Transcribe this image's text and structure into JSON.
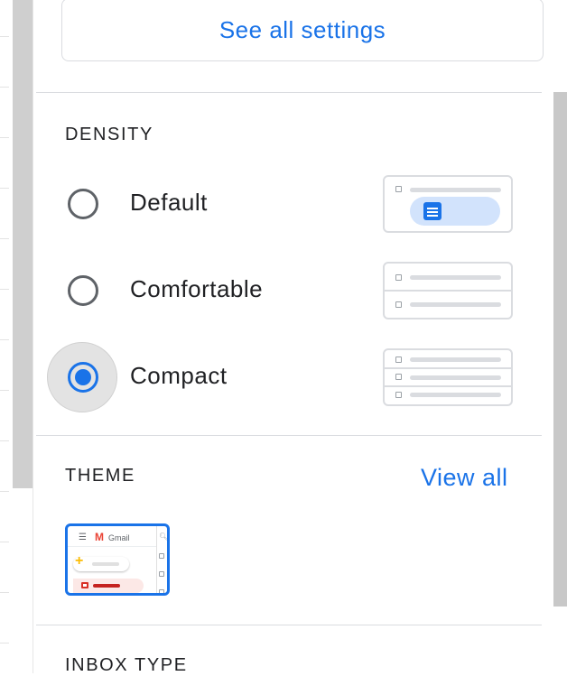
{
  "header": {
    "see_all_settings_label": "See all settings"
  },
  "density": {
    "title": "DENSITY",
    "selected": "Compact",
    "options": [
      {
        "label": "Default",
        "checked": false
      },
      {
        "label": "Comfortable",
        "checked": false
      },
      {
        "label": "Compact",
        "checked": true
      }
    ]
  },
  "theme": {
    "title": "THEME",
    "view_all_label": "View all",
    "thumbnail": {
      "app_name": "Gmail",
      "selected": true
    }
  },
  "inbox_type": {
    "title": "INBOX TYPE"
  },
  "colors": {
    "accent": "#1a73e8",
    "text": "#202124",
    "divider": "#dadce0"
  },
  "icons": [
    "radio-unchecked-icon",
    "radio-checked-icon",
    "density-preview-icon",
    "menu-icon",
    "gmail-logo-icon",
    "search-icon",
    "compose-plus-icon",
    "inbox-icon",
    "checkbox-icon",
    "document-icon"
  ]
}
